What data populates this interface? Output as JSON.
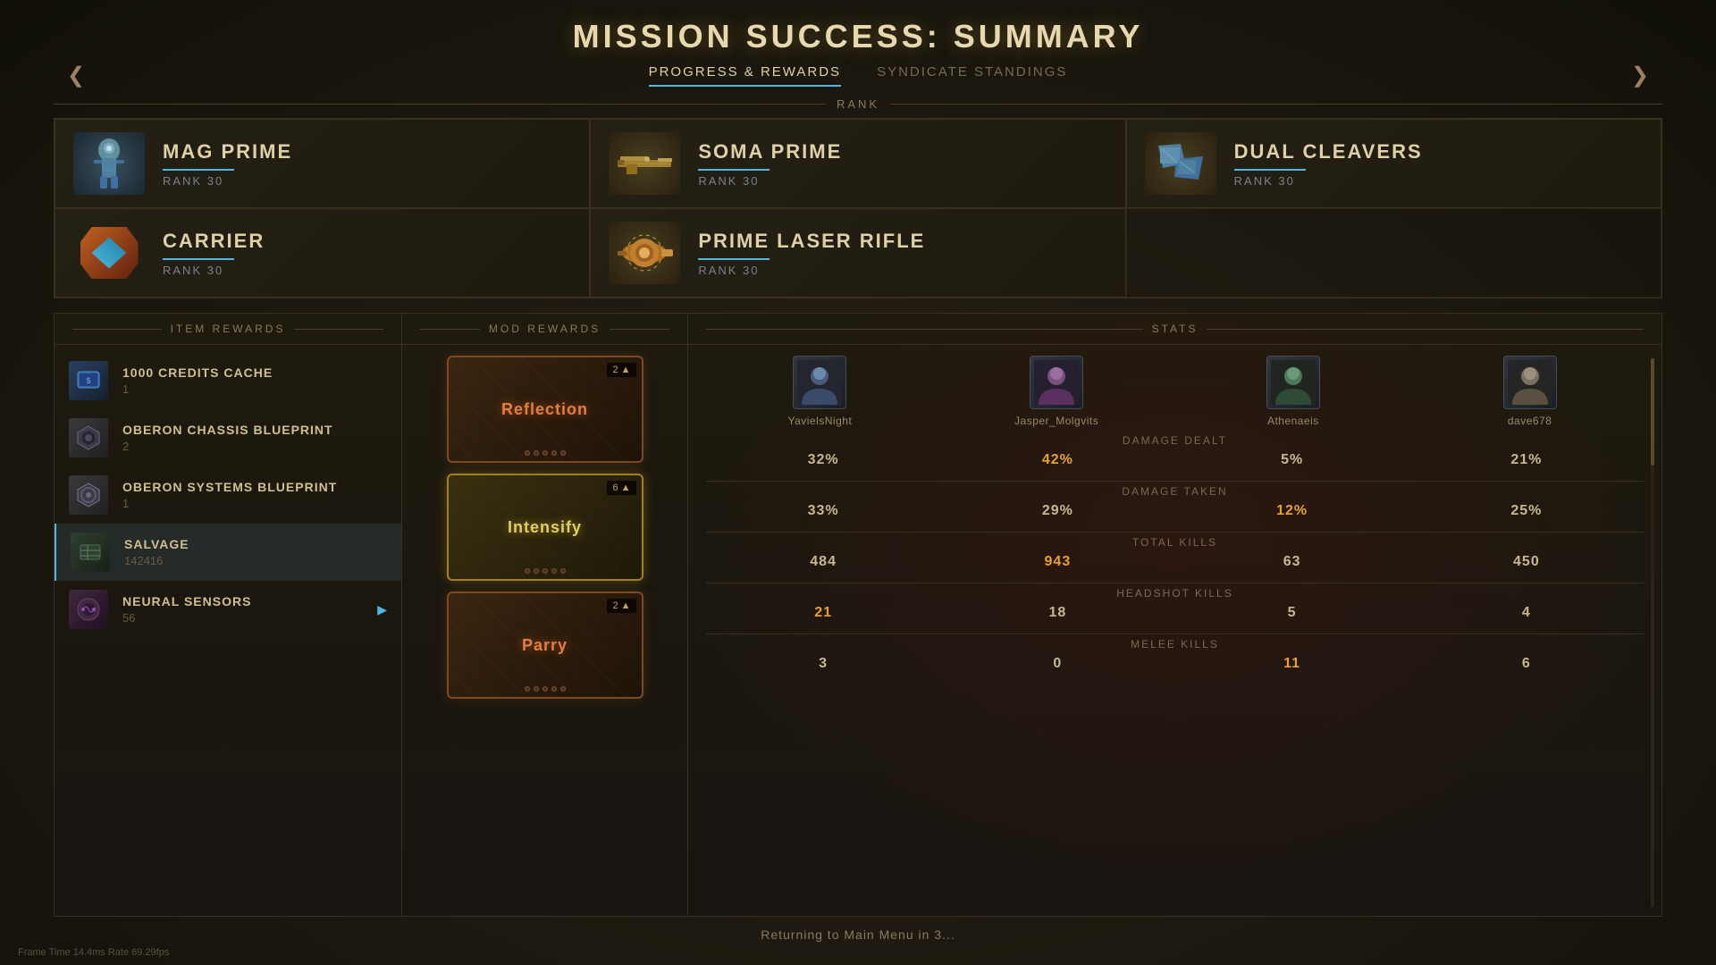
{
  "title": "MISSION SUCCESS: SUMMARY",
  "tabs": [
    {
      "label": "PROGRESS & REWARDS",
      "active": true
    },
    {
      "label": "SYNDICATE STANDINGS",
      "active": false
    }
  ],
  "rank_section": {
    "header": "RANK",
    "items": [
      {
        "name": "MAG PRIME",
        "rank": "RANK 30",
        "col": 0,
        "row": 0,
        "type": "warframe"
      },
      {
        "name": "SOMA PRIME",
        "rank": "RANK 30",
        "col": 1,
        "row": 0,
        "type": "rifle"
      },
      {
        "name": "DUAL CLEAVERS",
        "rank": "RANK 30",
        "col": 2,
        "row": 0,
        "type": "melee"
      },
      {
        "name": "CARRIER",
        "rank": "RANK 30",
        "col": 0,
        "row": 1,
        "type": "sentinel"
      },
      {
        "name": "PRIME LASER RIFLE",
        "rank": "RANK 30",
        "col": 1,
        "row": 1,
        "type": "rifle"
      }
    ]
  },
  "item_rewards": {
    "header": "ITEM REWARDS",
    "items": [
      {
        "name": "1000 CREDITS CACHE",
        "qty": "1",
        "icon": "💰",
        "icon_class": "item-icon-blue",
        "selected": false
      },
      {
        "name": "OBERON CHASSIS BLUEPRINT",
        "qty": "2",
        "icon": "📦",
        "icon_class": "item-icon-gray",
        "selected": false
      },
      {
        "name": "OBERON SYSTEMS BLUEPRINT",
        "qty": "1",
        "icon": "⚙",
        "icon_class": "item-icon-gray",
        "selected": false
      },
      {
        "name": "SALVAGE",
        "qty": "142416",
        "icon": "🔩",
        "icon_class": "item-icon-green",
        "selected": true
      },
      {
        "name": "NEURAL SENSORS",
        "qty": "56",
        "icon": "🧠",
        "icon_class": "item-icon-purple",
        "selected": false
      }
    ]
  },
  "mod_rewards": {
    "header": "MOD REWARDS",
    "mods": [
      {
        "name": "Reflection",
        "rank": "2",
        "style": "bronze",
        "dots": 5
      },
      {
        "name": "Intensify",
        "rank": "6",
        "style": "gold",
        "dots": 5
      },
      {
        "name": "Parry",
        "rank": "2",
        "style": "bronze",
        "dots": 5
      }
    ]
  },
  "stats": {
    "header": "STATS",
    "players": [
      {
        "name": "YavielsNight",
        "avatar": "👤"
      },
      {
        "name": "Jasper_Molgvits",
        "avatar": "👤"
      },
      {
        "name": "Athenaeis",
        "avatar": "👤"
      },
      {
        "name": "dave678",
        "avatar": "👤"
      }
    ],
    "categories": [
      {
        "label": "Damage Dealt",
        "values": [
          {
            "val": "32%",
            "highlight": false
          },
          {
            "val": "42%",
            "highlight": true
          },
          {
            "val": "5%",
            "highlight": false
          },
          {
            "val": "21%",
            "highlight": false
          }
        ]
      },
      {
        "label": "Damage Taken",
        "values": [
          {
            "val": "33%",
            "highlight": false
          },
          {
            "val": "29%",
            "highlight": false
          },
          {
            "val": "12%",
            "highlight": true
          },
          {
            "val": "25%",
            "highlight": false
          }
        ]
      },
      {
        "label": "Total Kills",
        "values": [
          {
            "val": "484",
            "highlight": false
          },
          {
            "val": "943",
            "highlight": true
          },
          {
            "val": "63",
            "highlight": false
          },
          {
            "val": "450",
            "highlight": false
          }
        ]
      },
      {
        "label": "Headshot Kills",
        "values": [
          {
            "val": "21",
            "highlight": true
          },
          {
            "val": "18",
            "highlight": false
          },
          {
            "val": "5",
            "highlight": false
          },
          {
            "val": "4",
            "highlight": false
          }
        ]
      },
      {
        "label": "Melee Kills",
        "values": [
          {
            "val": "3",
            "highlight": false
          },
          {
            "val": "0",
            "highlight": false
          },
          {
            "val": "11",
            "highlight": true
          },
          {
            "val": "6",
            "highlight": false
          }
        ]
      }
    ]
  },
  "bottom_bar": {
    "text": "Returning to Main Menu in 3..."
  },
  "fps": "Frame Time 14.4ms Rate 69.29fps"
}
